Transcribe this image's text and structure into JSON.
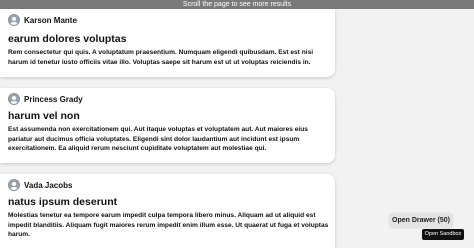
{
  "banner": {
    "text": "Scroll the page to see more results"
  },
  "posts": [
    {
      "author": "Karson Mante",
      "title": "earum dolores voluptas",
      "body": "Rem consectetur qui quis. A voluptatum praesentium. Numquam eligendi quibusdam. Est est nisi harum id tenetur iusto officiis vitae illo. Voluptas saepe sit harum est ut ut voluptas reiciendis in."
    },
    {
      "author": "Princess Grady",
      "title": "harum vel non",
      "body": "Est assumenda non exercitationem qui. Aut itaque voluptas et voluptatem aut. Aut maiores eius pariatur aut ducimus officia voluptates. Eligendi sint dolor laudantium aut incidunt est ipsum exercitationem. Ea aliquid rerum nesciunt cupiditate voluptatem aut molestiae qui."
    },
    {
      "author": "Vada Jacobs",
      "title": "natus ipsum deserunt",
      "body": "Molestias tenetur ea tempore earum impedit culpa tempora libero minus. Aliquam ad ut aliquid est impedit blanditiis. Aliquam fugit maiores rerum impedit enim illum esse. Ut quaerat ut fuga et voluptas harum."
    }
  ],
  "drawer_button": {
    "label": "Open Drawer (50)"
  },
  "sandbox_button": {
    "label": "Open Sandbox"
  },
  "icons": {
    "avatar": "user-avatar-icon"
  }
}
